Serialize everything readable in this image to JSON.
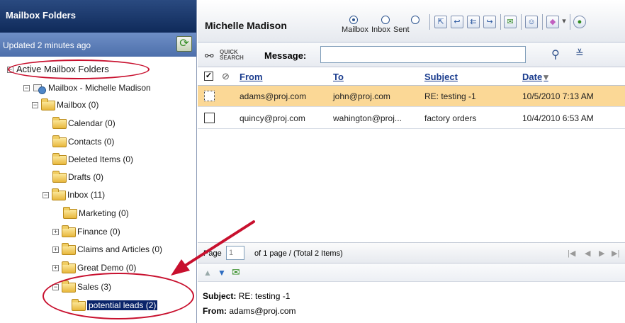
{
  "left_panel": {
    "title": "Mailbox Folders",
    "updated": "Updated 2 minutes ago",
    "refresh_icon": "refresh-icon",
    "tree": [
      {
        "label": "Active Mailbox Folders",
        "toggle": "⊟"
      },
      {
        "label": "Mailbox - Michelle Madison",
        "toggle": "−"
      },
      {
        "label": "Mailbox  (0)",
        "toggle": "−"
      },
      {
        "label": "Calendar (0)"
      },
      {
        "label": "Contacts (0)"
      },
      {
        "label": "Deleted Items (0)"
      },
      {
        "label": "Drafts (0)"
      },
      {
        "label": "Inbox (11)",
        "toggle": "−"
      },
      {
        "label": "Marketing (0)"
      },
      {
        "label": "Finance (0)",
        "toggle": "+"
      },
      {
        "label": "Claims and Articles (0)",
        "toggle": "+"
      },
      {
        "label": "Great Demo (0)",
        "toggle": "+"
      },
      {
        "label": "Sales (3)",
        "toggle": "−"
      },
      {
        "label": "potential leads (2)"
      }
    ]
  },
  "header": {
    "user_name": "Michelle Madison",
    "view_options": [
      "Mailbox",
      "Inbox",
      "Sent"
    ],
    "selected_view": "Mailbox"
  },
  "search": {
    "quick_line1": "QUICK",
    "quick_line2": "SEARCH",
    "message_label": "Message:",
    "message_value": ""
  },
  "grid": {
    "columns": [
      "From",
      "To",
      "Subject",
      "Date"
    ],
    "sort_indicator": "▾",
    "rows": [
      {
        "from": "adams@proj.com",
        "to": "john@proj.com",
        "subject": "RE: testing -1",
        "date": "10/5/2010 7:13 AM",
        "highlighted": true
      },
      {
        "from": "quincy@proj.com",
        "to": "wahington@proj...",
        "subject": "factory orders",
        "date": "10/4/2010 6:53 AM",
        "highlighted": false
      }
    ]
  },
  "pager": {
    "page_label": "Page",
    "page_value": "1",
    "summary": "of 1 page / (Total 2 Items)"
  },
  "preview": {
    "subject_key": "Subject:",
    "subject_value": "RE: testing -1",
    "from_key": "From:",
    "from_value": "adams@proj.com"
  },
  "colors": {
    "header_dark": "#0f2a5a",
    "highlight_row": "#fbd896",
    "annotation_red": "#c8102e",
    "link_blue": "#1a3c8e"
  }
}
